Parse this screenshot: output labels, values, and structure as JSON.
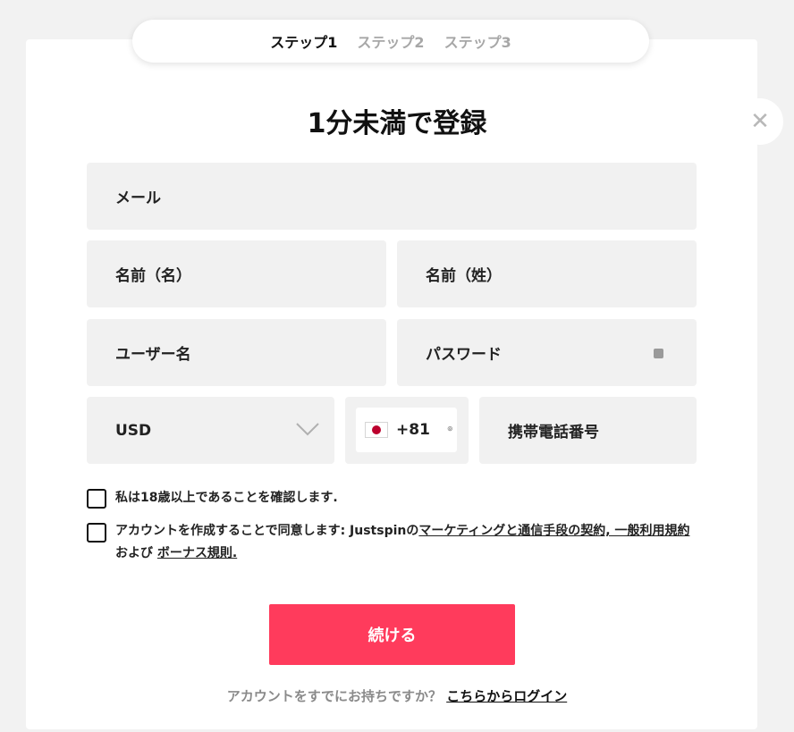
{
  "steps": [
    {
      "label": "ステップ1"
    },
    {
      "label": "ステップ2"
    },
    {
      "label": "ステップ3"
    }
  ],
  "title": "1分未満で登録",
  "fields": {
    "email": "メール",
    "first_name": "名前（名）",
    "last_name": "名前（姓）",
    "username": "ユーザー名",
    "password": "パスワード",
    "currency": "USD",
    "phone_code": "+81",
    "phone": "携帯電話番号"
  },
  "checkboxes": {
    "age": "私は18歳以上であることを確認します.",
    "terms_prefix": "アカウントを作成することで同意します: Justspinの",
    "terms_link1": "マーケティングと通信手段の契約, 一般利用規約",
    "terms_and": " および ",
    "terms_link2": "ボーナス規則."
  },
  "continue_label": "続ける",
  "login": {
    "prompt": "アカウントをすでにお持ちですか？",
    "link": "こちらからログイン"
  },
  "colors": {
    "accent": "#ff3b5c",
    "field_bg": "#f1f1f1",
    "page_bg": "#f2f2f2"
  },
  "icons": {
    "close": "close-icon",
    "password_toggle": "eye-icon",
    "currency_dropdown": "chevron-down-icon",
    "flag": "japan-flag-icon"
  }
}
